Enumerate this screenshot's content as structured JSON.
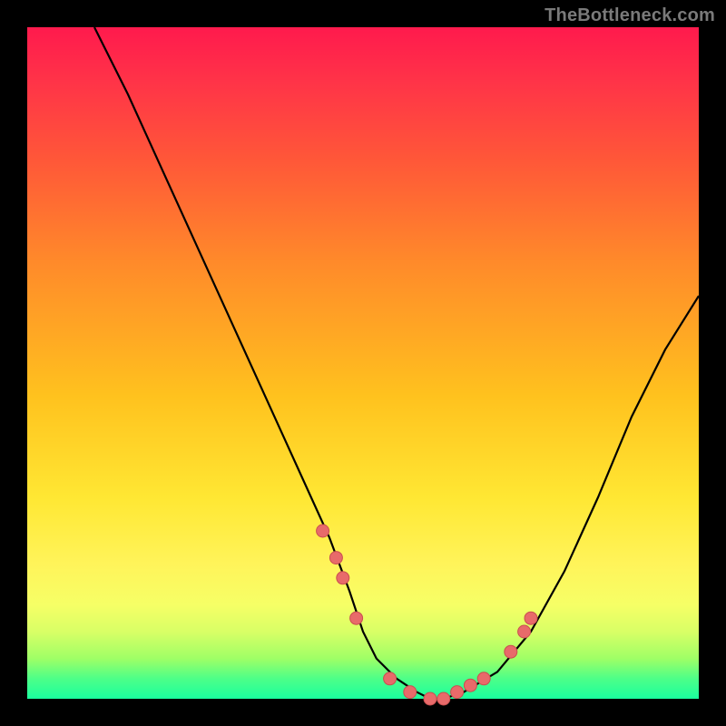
{
  "watermark": "TheBottleneck.com",
  "colors": {
    "background": "#000000",
    "curve_stroke": "#000000",
    "marker_fill": "#e86a6a",
    "marker_stroke": "#c94f4f"
  },
  "chart_data": {
    "type": "line",
    "title": "",
    "xlabel": "",
    "ylabel": "",
    "xlim": [
      0,
      100
    ],
    "ylim": [
      0,
      100
    ],
    "grid": false,
    "legend": false,
    "x": [
      10,
      15,
      20,
      25,
      30,
      35,
      40,
      45,
      48,
      50,
      52,
      55,
      58,
      60,
      62,
      65,
      70,
      75,
      80,
      85,
      90,
      95,
      100
    ],
    "values": [
      100,
      90,
      79,
      68,
      57,
      46,
      35,
      24,
      16,
      10,
      6,
      3,
      1,
      0,
      0,
      1,
      4,
      10,
      19,
      30,
      42,
      52,
      60
    ],
    "series": [
      {
        "name": "markers",
        "x": [
          44,
          46,
          47,
          49,
          54,
          57,
          60,
          62,
          64,
          66,
          68,
          72,
          74,
          75
        ],
        "values": [
          25,
          21,
          18,
          12,
          3,
          1,
          0,
          0,
          1,
          2,
          3,
          7,
          10,
          12
        ]
      }
    ]
  }
}
